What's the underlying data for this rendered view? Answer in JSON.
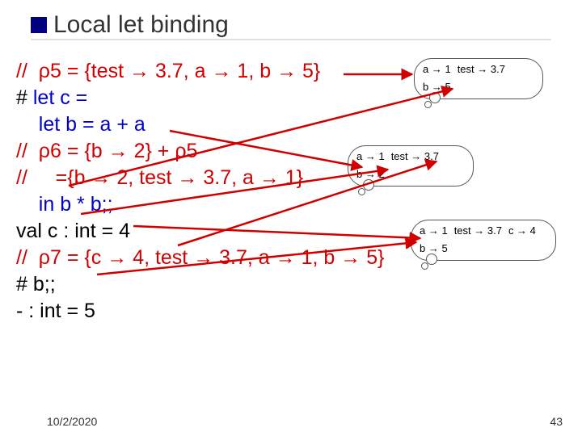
{
  "title": "Local let binding",
  "code": {
    "l1_a": "//  ",
    "l1_rho": "ρ5",
    "l1_b": " = {test ",
    "l1_arr1": "→",
    "l1_c": " 3.7, a ",
    "l1_arr2": "→",
    "l1_d": " 1, b ",
    "l1_arr3": "→",
    "l1_e": " 5}",
    "l2": "# ",
    "l2b": "let c =",
    "l3a": "    ",
    "l3b": "let b = a + a",
    "l4a": "//  ",
    "l4rho": "ρ6",
    "l4b": " = {b ",
    "l4arr": "→",
    "l4c": " 2} + ",
    "l4rho2": "ρ5",
    "l5a": "//     ={b ",
    "l5arr1": "→",
    "l5b": " 2, test ",
    "l5arr2": "→",
    "l5c": " 3.7, a ",
    "l5arr3": "→",
    "l5d": " 1}",
    "l6a": "    ",
    "l6b": "in b * b;;",
    "l7": "val c : int = 4",
    "l8a": "//  ",
    "l8rho": "ρ7",
    "l8b": " = {c ",
    "l8arr1": "→",
    "l8c": " 4, test ",
    "l8arr2": "→",
    "l8d": " 3.7, a ",
    "l8arr3": "→",
    "l8e": " 1, b ",
    "l8arr4": "→",
    "l8f": " 5}",
    "l9": "# b;;",
    "l10": "- : int = 5"
  },
  "clouds": {
    "c1": {
      "p1": "a → 1",
      "p2": "test → 3.7",
      "p3": "b → 5"
    },
    "c2": {
      "p1": "a → 1",
      "p2": "test → 3.7",
      "p3": "b → 2"
    },
    "c3": {
      "p1": "a → 1",
      "p2": "test → 3.7",
      "p3": "c → 4",
      "p4": "b → 5"
    }
  },
  "footer": {
    "date": "10/2/2020",
    "page": "43"
  }
}
